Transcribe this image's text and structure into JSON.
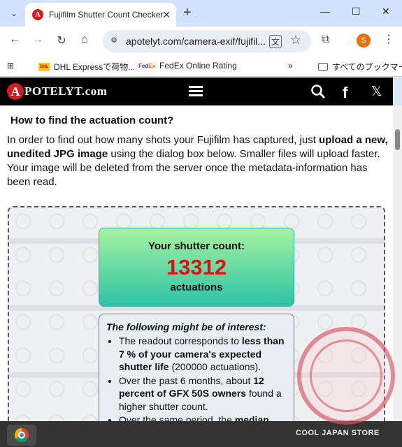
{
  "browser": {
    "tab_title": "Fujifilm Shutter Count Checker",
    "new_tab": "+",
    "window_controls": {
      "minimize": "—",
      "maximize": "☐",
      "close": "✕"
    },
    "url": "apotelyt.com/camera-exif/fujifil...",
    "profile_initial": "S",
    "nav": {
      "back": "←",
      "forward": "→",
      "reload": "↻",
      "home": "⌂",
      "menu": "⋮"
    }
  },
  "bookmarks": [
    {
      "label": "DHL Expressで荷物...",
      "icon": "dhl-icon"
    },
    {
      "label": "FedEx Online Rating",
      "icon": "fedex-icon"
    }
  ],
  "bookmarks_overflow": "»",
  "bookmarks_folder": "すべてのブックマーク",
  "site": {
    "logo_letter": "A",
    "logo_text": "POTELYT.com",
    "brand_color": "#d71920"
  },
  "content": {
    "heading": "How to find the actuation count?",
    "intro_1": "In order to find out how many shots your Fujifilm has captured, just ",
    "intro_bold": "upload a new, unedited JPG image",
    "intro_2": " using the dialog box below. Smaller files will upload faster. Your image will be deleted from the server once the metadata-information has been read.",
    "count_label": "Your shutter count:",
    "count_value": "13312",
    "count_unit": "actuations",
    "info_heading": "The following might be of interest:",
    "info_items": [
      {
        "a": "The readout corresponds to ",
        "b": "less than 7 % of your camera's expected shutter life",
        "c": " (200000 actuations)."
      },
      {
        "a": "Over the past 6 months, about ",
        "b": "12 percent of GFX 50S owners",
        "c": " found a higher shutter count."
      },
      {
        "a": "Over the same period, the ",
        "b": "median",
        "c": ""
      }
    ]
  },
  "watermark": {
    "text": "COOL JAPAN STORE"
  }
}
